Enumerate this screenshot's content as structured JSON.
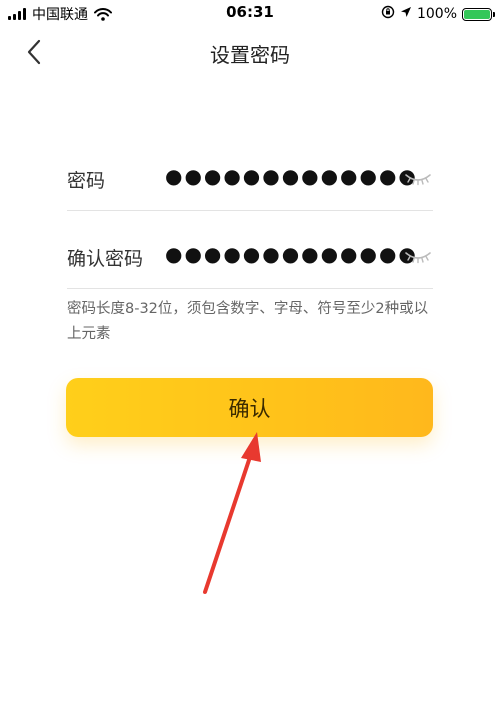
{
  "status_bar": {
    "carrier": "中国联通",
    "time": "06:31",
    "battery": "100%",
    "battery_level": 1.0,
    "icons": [
      "signal-icon",
      "wifi-icon",
      "orientation-lock-icon",
      "location-icon",
      "battery-charging-icon"
    ]
  },
  "nav": {
    "title": "设置密码",
    "back_icon": "chevron-left-icon"
  },
  "form": {
    "password_label": "密码",
    "password_value": "●●●●●●●●●●●●●",
    "confirm_label": "确认密码",
    "confirm_value": "●●●●●●●●●●●●●",
    "visibility_icon": "eye-closed-icon"
  },
  "hint": "密码长度8-32位，须包含数字、字母、符号至少2种或以上元素",
  "confirm_button": "确认",
  "colors": {
    "button_start": "#ffcf1a",
    "button_end": "#ffb81c",
    "annotation_arrow": "#e8392f",
    "divider": "#e3e3e3"
  }
}
